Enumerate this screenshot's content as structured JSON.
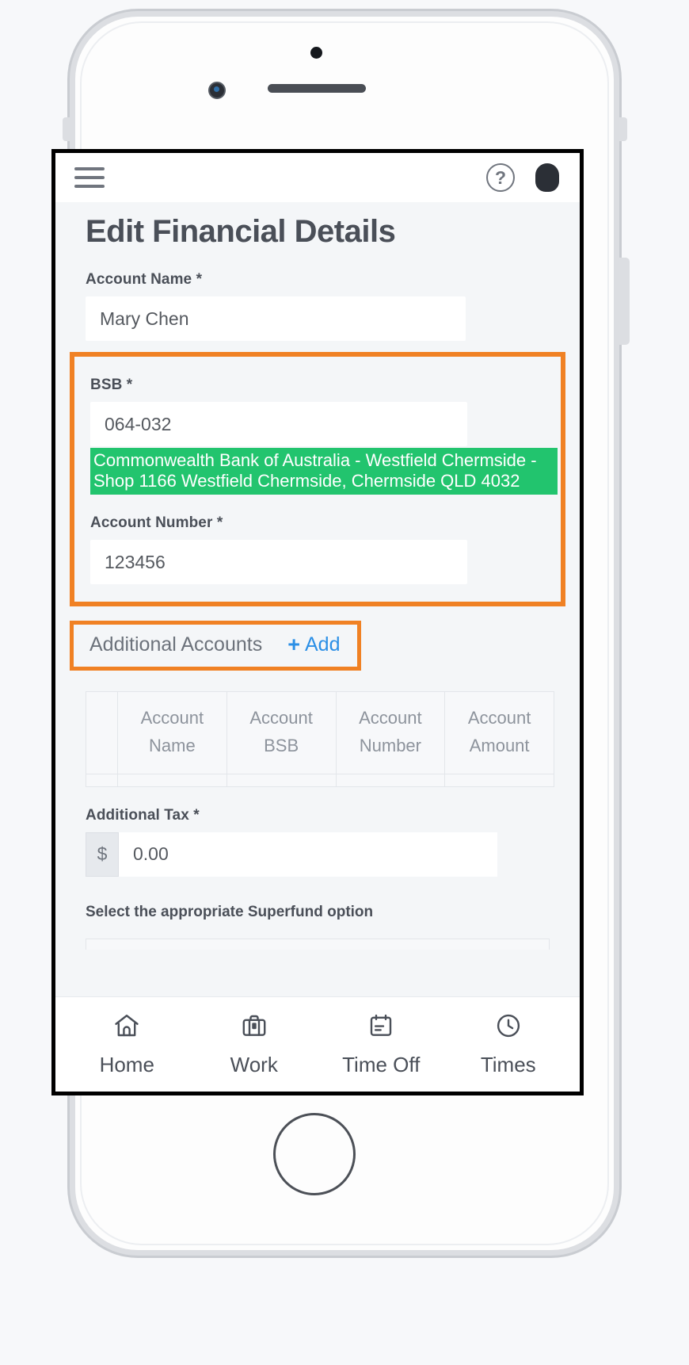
{
  "app_bar": {
    "menu_icon": "hamburger-menu-icon",
    "help_icon": "?",
    "help_icon_name": "help-circle-icon",
    "avatar_name": "user-avatar"
  },
  "page": {
    "title": "Edit Financial Details"
  },
  "form": {
    "account_name": {
      "label": "Account Name *",
      "value": "Mary Chen",
      "placeholder": "Account Name"
    },
    "bsb": {
      "label": "BSB *",
      "value": "064-032",
      "placeholder": "BSB",
      "result_text": "Commonwealth Bank of Australia - Westfield Chermside - Shop 1166 Westfield Chermside, Chermside QLD 4032",
      "result_bg": "#22c46e"
    },
    "account_number": {
      "label": "Account Number *",
      "value": "123456",
      "placeholder": "Account Number"
    },
    "additional_accounts": {
      "label": "Additional Accounts",
      "add_plus": "+",
      "add_label": "Add",
      "add_color": "#2b8fe6"
    },
    "accounts_table": {
      "columns": [
        "",
        "Account Name",
        "Account BSB",
        "Account Number",
        "Account Amount"
      ],
      "rows": []
    },
    "additional_tax": {
      "label": "Additional Tax *",
      "currency_prefix": "$",
      "value": "0.00",
      "placeholder": "0.00"
    },
    "superfund": {
      "label": "Select the appropriate Superfund option"
    }
  },
  "highlight": {
    "color": "#f08124"
  },
  "bottom_nav": {
    "items": [
      {
        "label": "Home",
        "icon": "home-icon"
      },
      {
        "label": "Work",
        "icon": "briefcase-icon"
      },
      {
        "label": "Time Off",
        "icon": "calendar-notes-icon"
      },
      {
        "label": "Times",
        "icon": "clock-icon"
      }
    ]
  }
}
